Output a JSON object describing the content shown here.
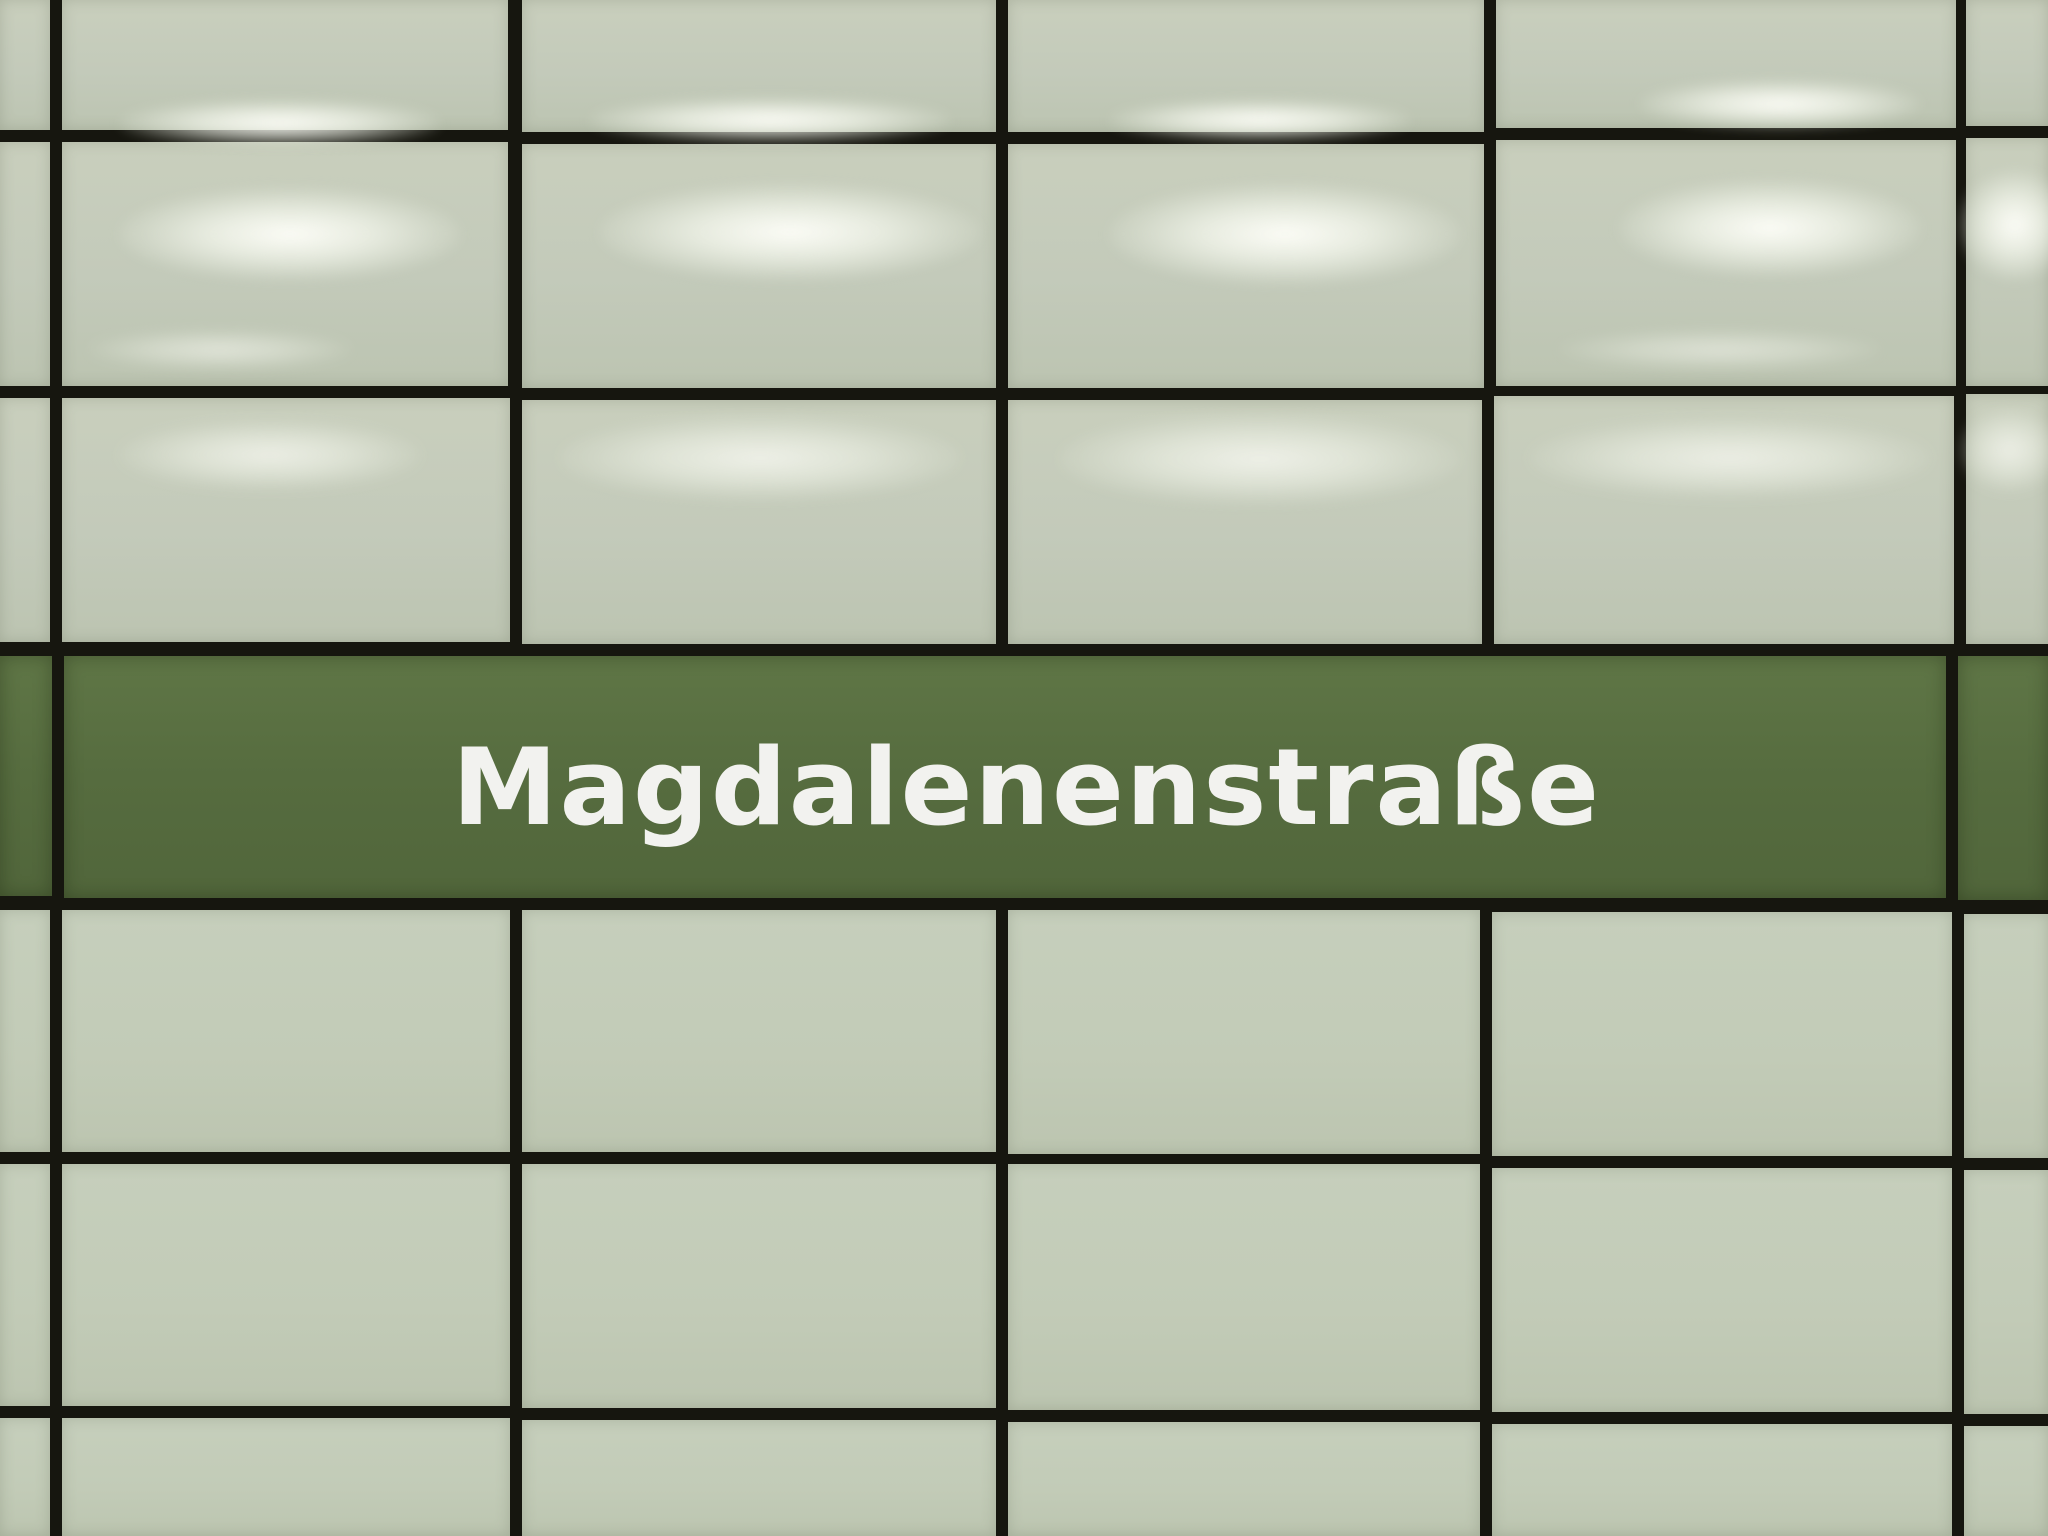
{
  "sign": {
    "station_name": "Magdalenenstraße"
  },
  "colors": {
    "tile": "#c4cbb8",
    "band": "#566c3f",
    "grout": "#16160f",
    "lettering": "#f2f2ef"
  }
}
